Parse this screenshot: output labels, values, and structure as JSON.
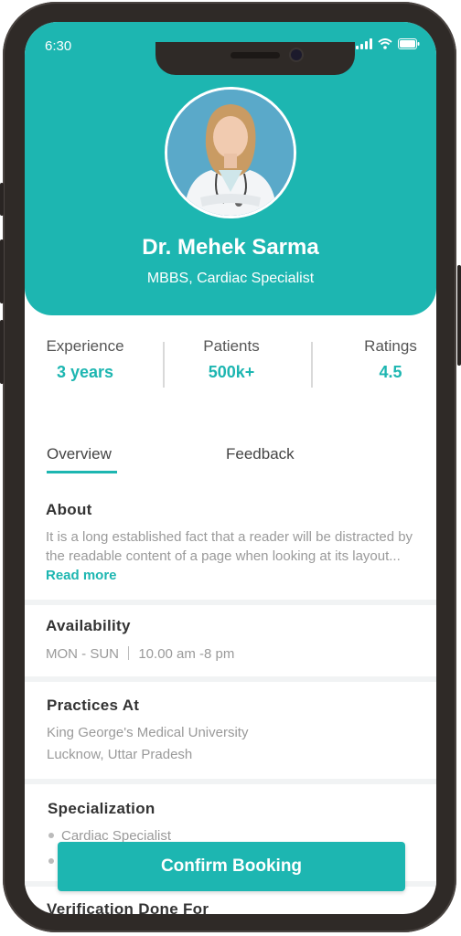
{
  "status_bar": {
    "time": "6:30"
  },
  "doctor": {
    "name": "Dr. Mehek Sarma",
    "degree": "MBBS, Cardiac Specialist"
  },
  "stats": [
    {
      "label": "Experience",
      "value": "3 years"
    },
    {
      "label": "Patients",
      "value": "500k+"
    },
    {
      "label": "Ratings",
      "value": "4.5"
    }
  ],
  "tabs": [
    {
      "label": "Overview",
      "active": true
    },
    {
      "label": "Feedback",
      "active": false
    }
  ],
  "about": {
    "title": "About",
    "text": "It is a long established fact that a reader will be distracted by the readable content of a page when looking at its layout...",
    "read_more": "Read more"
  },
  "availability": {
    "title": "Availability",
    "days": "MON - SUN",
    "hours": "10.00 am -8 pm"
  },
  "practices": {
    "title": "Practices At",
    "line1": "King George's Medical University",
    "line2": "Lucknow, Uttar Pradesh"
  },
  "specialization": {
    "title": "Specialization",
    "items": [
      "Cardiac Specialist"
    ]
  },
  "verification": {
    "title": "Verification Done For"
  },
  "confirm_button": "Confirm Booking",
  "colors": {
    "accent": "#1db6b1",
    "frame": "#2f2a27"
  },
  "icons": [
    "signal-icon",
    "wifi-icon",
    "battery-icon",
    "camera-icon"
  ]
}
